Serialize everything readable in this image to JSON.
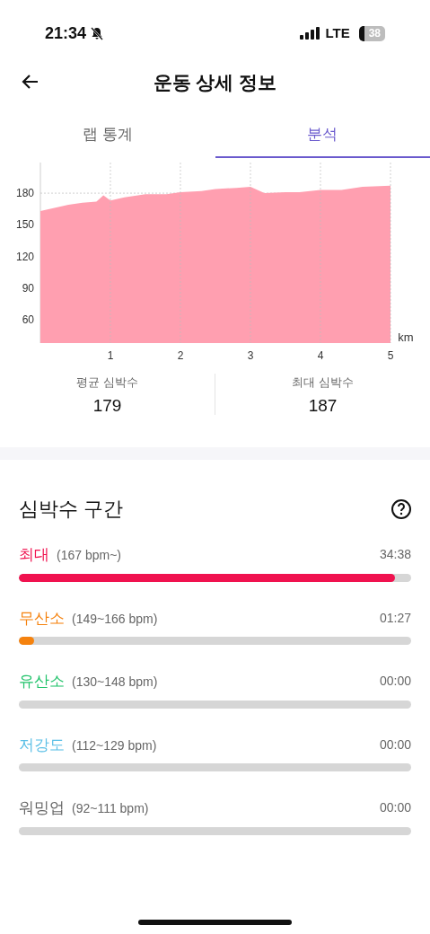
{
  "status_bar": {
    "time": "21:34",
    "network": "LTE",
    "battery": "38"
  },
  "header": {
    "title": "운동 상세 정보"
  },
  "tabs": [
    {
      "label": "랩 통계",
      "selected": false
    },
    {
      "label": "분석",
      "selected": true
    }
  ],
  "chart_data": {
    "type": "area",
    "xlabel": "km",
    "x": [
      0,
      0.2,
      0.4,
      0.6,
      0.8,
      0.9,
      1.0,
      1.2,
      1.5,
      1.8,
      2.0,
      2.3,
      2.5,
      2.8,
      3.0,
      3.2,
      3.5,
      3.7,
      4.0,
      4.3,
      4.6,
      5.0
    ],
    "grid": true,
    "series": [
      {
        "color": "#ff9fb0",
        "values": [
          163,
          166,
          169,
          171,
          172,
          178,
          173,
          176,
          179,
          179,
          181,
          182,
          184,
          185,
          186,
          180,
          181,
          181,
          183,
          183,
          186,
          187
        ]
      }
    ],
    "xlim": [
      0,
      5
    ],
    "ylim": [
      38,
      209
    ],
    "xticks": [
      1,
      2,
      3,
      4,
      5
    ],
    "yticks": [
      60,
      90,
      120,
      150,
      180
    ]
  },
  "stats": [
    {
      "label": "평균 심박수",
      "value": "179"
    },
    {
      "label": "최대 심박수",
      "value": "187"
    }
  ],
  "zones": {
    "title": "심박수 구간",
    "items": [
      {
        "name": "최대",
        "range": "(167 bpm~)",
        "time": "34:38",
        "level": 0.958,
        "color": "#f0124f"
      },
      {
        "name": "무산소",
        "range": "(149~166 bpm)",
        "time": "01:27",
        "level": 0.04,
        "color": "#f5820e"
      },
      {
        "name": "유산소",
        "range": "(130~148 bpm)",
        "time": "00:00",
        "color": "#22c36b"
      },
      {
        "name": "저강도",
        "range": "(112~129 bpm)",
        "time": "00:00",
        "color": "#5bbfe6"
      },
      {
        "name": "워밍업",
        "range": "(92~111 bpm)",
        "time": "00:00",
        "color": "#666666"
      }
    ]
  }
}
